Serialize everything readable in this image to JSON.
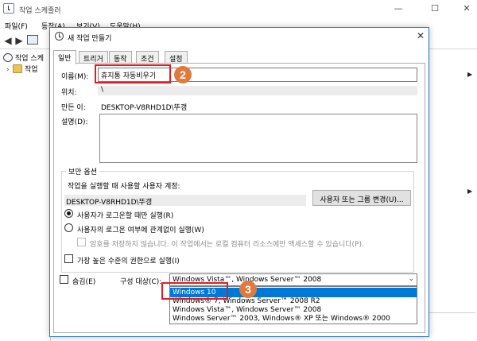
{
  "background_window": {
    "title": "작업 스케줄러",
    "menu": [
      "파일(F)",
      "동작(A)",
      "보기(V)",
      "도움말(H)"
    ],
    "tree": [
      {
        "label": "작업 스케",
        "icon": "clock-icon"
      },
      {
        "label": "작업",
        "icon": "folder-icon"
      }
    ],
    "controls": {
      "minimize": "—",
      "maximize": "☐",
      "close": "✕"
    }
  },
  "dialog": {
    "title": "새 작업 만들기",
    "close_glyph": "✕",
    "tabs": [
      {
        "label": "일반",
        "active": true
      },
      {
        "label": "트리거",
        "active": false
      },
      {
        "label": "동작",
        "active": false
      },
      {
        "label": "조건",
        "active": false
      },
      {
        "label": "설정",
        "active": false
      }
    ],
    "general": {
      "name_label": "이름(M):",
      "name_value": "휴지통 자동비우기",
      "location_label": "위치:",
      "location_value": "\\",
      "author_label": "만든 이:",
      "author_value": "DESKTOP-V8RHD1D\\뚜갱",
      "description_label": "설명(D):",
      "description_value": ""
    },
    "security": {
      "legend": "보안 옵션",
      "account_prompt": "작업을 실행할 때 사용할 사용자 계정:",
      "account_value": "DESKTOP-V8RHD1D\\뚜갱",
      "change_button": "사용자 또는 그룹 변경(U)...",
      "radio_logged_on": "사용자가 로그온할 때만 실행(R)",
      "radio_whether": "사용자의 로그온 여부에 관계없이 실행(W)",
      "no_store_password": "암호를 저장하지 않습니다. 이 작업에서는 로컬 컴퓨터 리소스에만 액세스할 수 있습니다(P).",
      "highest_privileges": "가장 높은 수준의 권한으로 실행(I)",
      "selected_radio": "logged_on"
    },
    "bottom": {
      "hidden_label": "숨김(E)",
      "configure_label": "구성 대상(C):",
      "configure_value": "Windows Vista™, Windows Server™ 2008",
      "options": [
        {
          "label": "Windows 10",
          "selected": true
        },
        {
          "label": "Windows® 7, Windows Server™ 2008 R2",
          "selected": false
        },
        {
          "label": "Windows Vista™, Windows Server™ 2008",
          "selected": false
        },
        {
          "label": "Windows Server™ 2003, Windows® XP 또는 Windows® 2000",
          "selected": false
        }
      ]
    }
  },
  "annotations": {
    "step_name": "2",
    "step_configure": "3",
    "highlight_color": "#e31b23",
    "badge_color": "#e07a3c"
  },
  "colors": {
    "dialog_border": "#2b78c5",
    "selection": "#0078d7"
  }
}
